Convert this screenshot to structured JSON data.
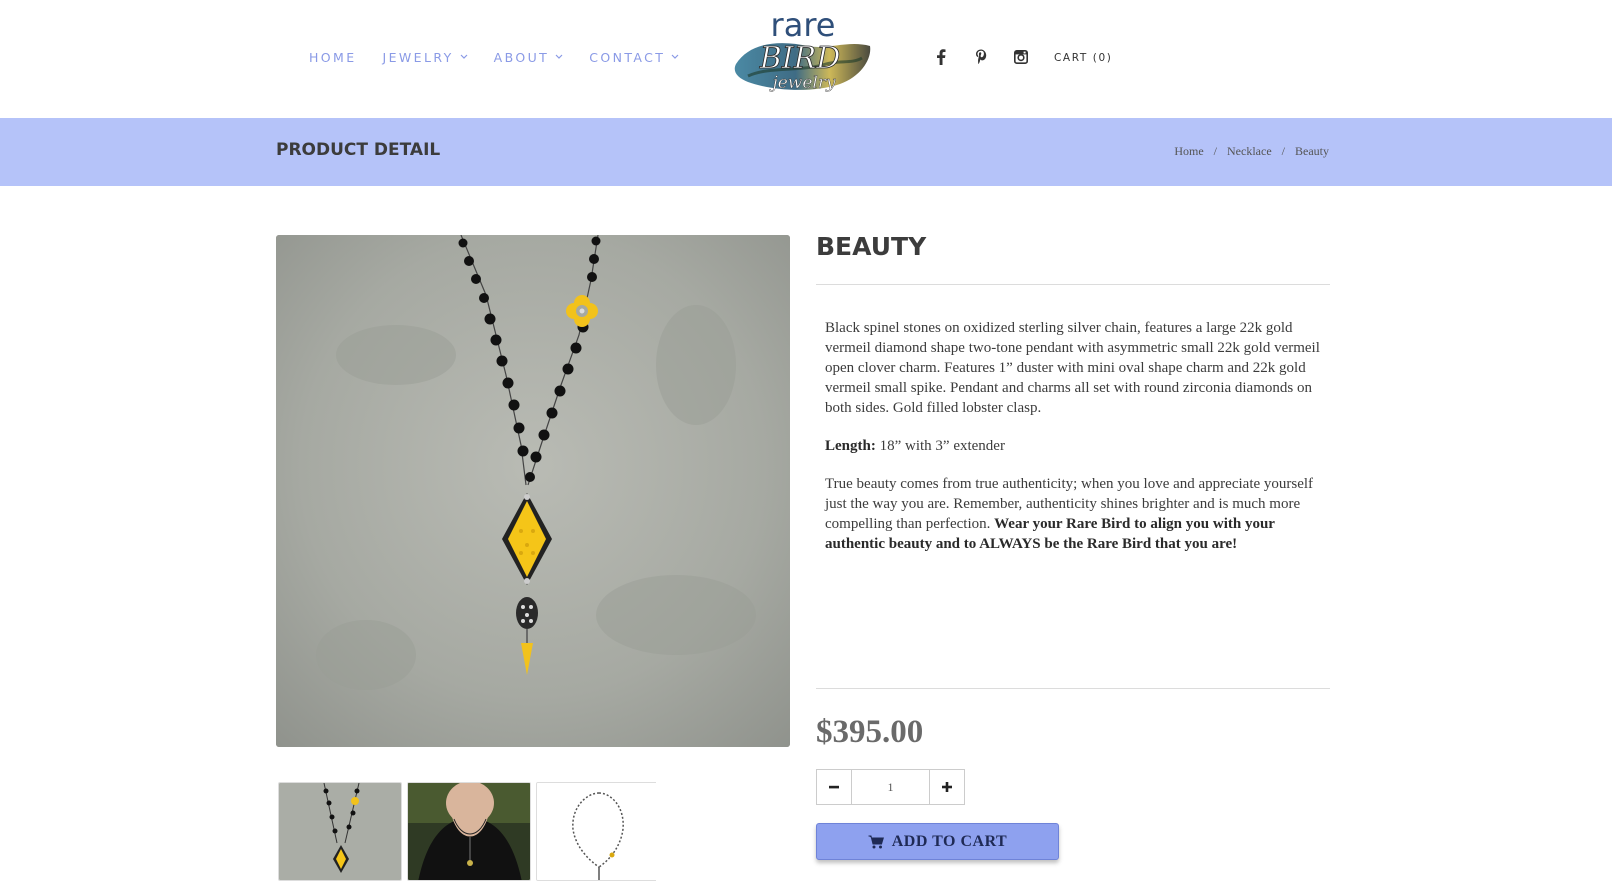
{
  "nav": {
    "items": [
      {
        "label": "HOME",
        "dropdown": false
      },
      {
        "label": "JEWELRY",
        "dropdown": true
      },
      {
        "label": "ABOUT",
        "dropdown": true
      },
      {
        "label": "CONTACT",
        "dropdown": true
      }
    ],
    "cart_label": "CART (0)"
  },
  "logo": {
    "line1": "rare",
    "line2": "BIRD",
    "line3": "jewelry"
  },
  "social": [
    "facebook-icon",
    "pinterest-icon",
    "instagram-icon"
  ],
  "banner": {
    "title": "PRODUCT DETAIL",
    "breadcrumb": [
      "Home",
      "Necklace",
      "Beauty"
    ],
    "separator": "/"
  },
  "product": {
    "title": "BEAUTY",
    "description": "Black spinel stones on oxidized sterling silver chain, features a large 22k gold vermeil diamond shape two-tone pendant with asymmetric small 22k gold vermeil open clover charm. Features 1” duster with mini oval shape charm and 22k gold vermeil small spike. Pendant and charms all set with round zirconia diamonds on both sides. Gold filled lobster clasp.",
    "length_label": "Length:",
    "length_value": "18” with 3” extender",
    "story_plain": "True beauty comes from true authenticity; when you love and appreciate yourself just the way you are. Remember, authenticity shines brighter and is much more compelling than perfection.",
    "story_bold": "Wear your Rare Bird to align you with your authentic beauty and to ALWAYS be the Rare Bird that you are!",
    "price": "$395.00",
    "quantity": "1",
    "add_to_cart": "ADD TO CART"
  },
  "colors": {
    "accent": "#8a9ae6",
    "banner": "#b5c3f9",
    "button": "#8ea1ef"
  }
}
